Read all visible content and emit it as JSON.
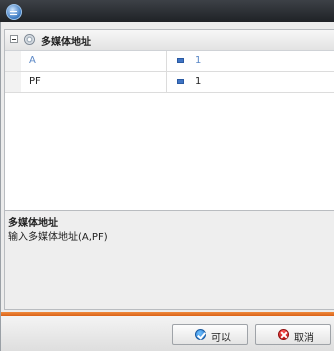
{
  "grid": {
    "category": {
      "label": "多媒体地址"
    },
    "properties": [
      {
        "name": "A",
        "value": "1"
      },
      {
        "name": "PF",
        "value": "1"
      }
    ]
  },
  "description": {
    "title": "多媒体地址",
    "text": "输入多媒体地址(A,PF)"
  },
  "buttons": {
    "ok_label": "可以",
    "cancel_label": "取消"
  },
  "colors": {
    "accent_bar": "#e8742a",
    "titlebar": "#2b2e33",
    "value_icon": "#3f74c4"
  },
  "icons": {
    "app": "app-logo-icon",
    "category": "settings-circle-icon",
    "value": "value-marker-icon",
    "ok": "checkmark-icon",
    "cancel": "close-icon"
  }
}
